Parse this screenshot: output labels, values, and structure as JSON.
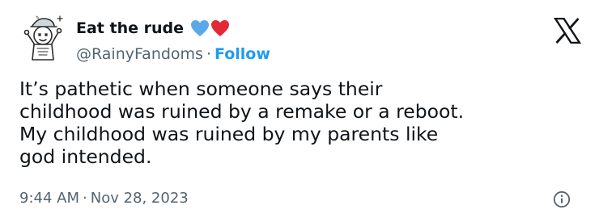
{
  "tweet": {
    "display_name": "Eat the rude",
    "handle": "@RainyFandoms",
    "separator": "·",
    "follow_label": "Follow",
    "text": "It’s pathetic when someone says their\nchildhood was ruined by a remake or a reboot.\nMy childhood was ruined by my parents like\ngod intended.",
    "time": "9:44 AM",
    "date": "Nov 28, 2023",
    "emojis": [
      "blue-heart",
      "red-heart"
    ]
  },
  "icons": {
    "platform": "x-logo",
    "info": "info-icon"
  },
  "colors": {
    "text": "#0f1419",
    "secondary": "#536471",
    "accent": "#1d9bf0",
    "blue_heart": "#5aa9e6",
    "red_heart": "#e02a36"
  }
}
